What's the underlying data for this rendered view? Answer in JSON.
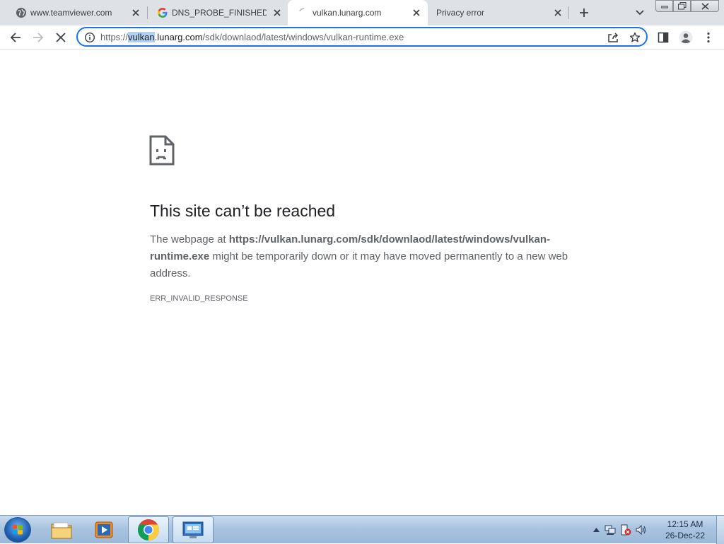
{
  "tabs": [
    {
      "title": "www.teamviewer.com",
      "favicon": "globe-icon"
    },
    {
      "title": "DNS_PROBE_FINISHED_N",
      "favicon": "google-icon"
    },
    {
      "title": "vulkan.lunarg.com",
      "favicon": "loading-spinner-icon"
    },
    {
      "title": "Privacy error",
      "favicon": "none"
    }
  ],
  "active_tab_index": 2,
  "omnibox": {
    "scheme": "https://",
    "host_selected": "vulkan",
    "host_rest": ".lunarg.com",
    "path": "/sdk/downlaod/latest/windows/vulkan-runtime.exe"
  },
  "error_page": {
    "title": "This site can’t be reached",
    "desc_prefix": "The webpage at ",
    "desc_url": "https://vulkan.lunarg.com/sdk/downlaod/latest/windows/vulkan-runtime.exe",
    "desc_suffix": " might be temporarily down or it may have moved permanently to a new web address.",
    "error_code": "ERR_INVALID_RESPONSE"
  },
  "taskbar": {
    "items": [
      "file-explorer-icon",
      "media-player-icon",
      "chrome-icon",
      "remote-desktop-icon"
    ],
    "clock_time": "12:15 AM",
    "clock_date": "26-Dec-22"
  },
  "colors": {
    "accent": "#1a73e8",
    "tabstrip_bg": "#dee1e6",
    "text_primary": "#202124",
    "text_secondary": "#5f6368"
  }
}
